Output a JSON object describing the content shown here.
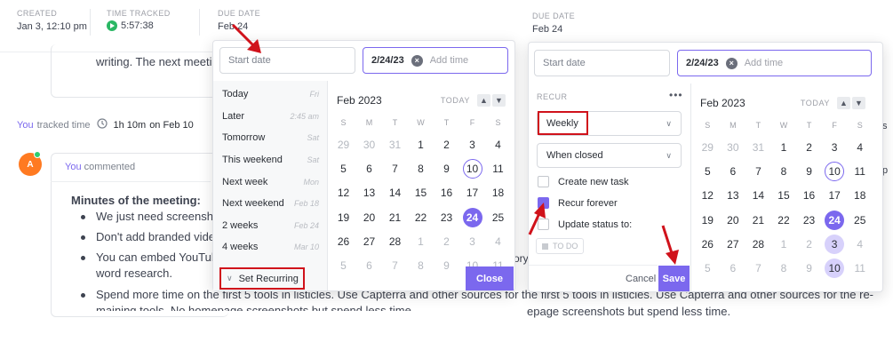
{
  "header": {
    "created_label": "CREATED",
    "created_value": "Jan 3, 12:10 pm",
    "time_label": "TIME TRACKED",
    "time_value": "5:57:38",
    "due_label": "DUE DATE",
    "due_value": "Feb 24",
    "due_label_right": "DUE DATE",
    "due_value_right": "Feb 24"
  },
  "background": {
    "desc_line": "writing. The next meetir",
    "tracked_you": "You",
    "tracked_text": "tracked time",
    "tracked_duration": "1h 10m",
    "tracked_on": "on Feb 10",
    "comment_avatar": "A",
    "comment_you": "You",
    "comment_action": "commented",
    "heading": "Minutes of the meeting:",
    "bullets": [
      "We just need screensho",
      "Don't add branded vide",
      "You can embed YouTub",
      "Spend more time on the first 5 tools in listicles. Use Capterra and other sources for the first 5 tools in listicles. Use Capterra and other sources for the re-"
    ],
    "bullet3_cont": "word research.",
    "last_line_left": "maining tools. No homepage screenshots but spend less time",
    "last_line_right": "epage screenshots but spend less time.",
    "right_edge_mid": "ory",
    "right_edge_top": "s",
    "right_edge_bottom": "p"
  },
  "left_picker": {
    "start_placeholder": "Start date",
    "due_value": "2/24/23",
    "add_time": "Add time",
    "quick_options": [
      {
        "label": "Today",
        "hint": "Fri"
      },
      {
        "label": "Later",
        "hint": "2:45 am"
      },
      {
        "label": "Tomorrow",
        "hint": "Sat"
      },
      {
        "label": "This weekend",
        "hint": "Sat"
      },
      {
        "label": "Next week",
        "hint": "Mon"
      },
      {
        "label": "Next weekend",
        "hint": "Feb 18"
      },
      {
        "label": "2 weeks",
        "hint": "Feb 24"
      },
      {
        "label": "4 weeks",
        "hint": "Mar 10"
      }
    ],
    "set_recurring": "Set Recurring",
    "month": "Feb 2023",
    "today_btn": "TODAY",
    "close_btn": "Close"
  },
  "right_picker": {
    "start_placeholder": "Start date",
    "due_value": "2/24/23",
    "add_time": "Add time",
    "recur_label": "RECUR",
    "more": "•••",
    "frequency": "Weekly",
    "when": "When closed",
    "options": [
      "Create new task",
      "Recur forever",
      "Update status to:"
    ],
    "status_pill": "TO DO",
    "month": "Feb 2023",
    "today_btn": "TODAY",
    "cancel": "Cancel",
    "save": "Save"
  },
  "calendar": {
    "dow": [
      "S",
      "M",
      "T",
      "W",
      "T",
      "F",
      "S"
    ],
    "rows": [
      [
        "29",
        "30",
        "31",
        "1",
        "2",
        "3",
        "4"
      ],
      [
        "5",
        "6",
        "7",
        "8",
        "9",
        "10",
        "11"
      ],
      [
        "12",
        "13",
        "14",
        "15",
        "16",
        "17",
        "18"
      ],
      [
        "19",
        "20",
        "21",
        "22",
        "23",
        "24",
        "25"
      ],
      [
        "26",
        "27",
        "28",
        "1",
        "2",
        "3",
        "4"
      ],
      [
        "5",
        "6",
        "7",
        "8",
        "9",
        "10",
        "11"
      ]
    ]
  },
  "colors": {
    "accent": "#7b68ee",
    "annotation": "#d0121b",
    "tracker": "#2ab764",
    "avatar": "#ff7a21"
  }
}
